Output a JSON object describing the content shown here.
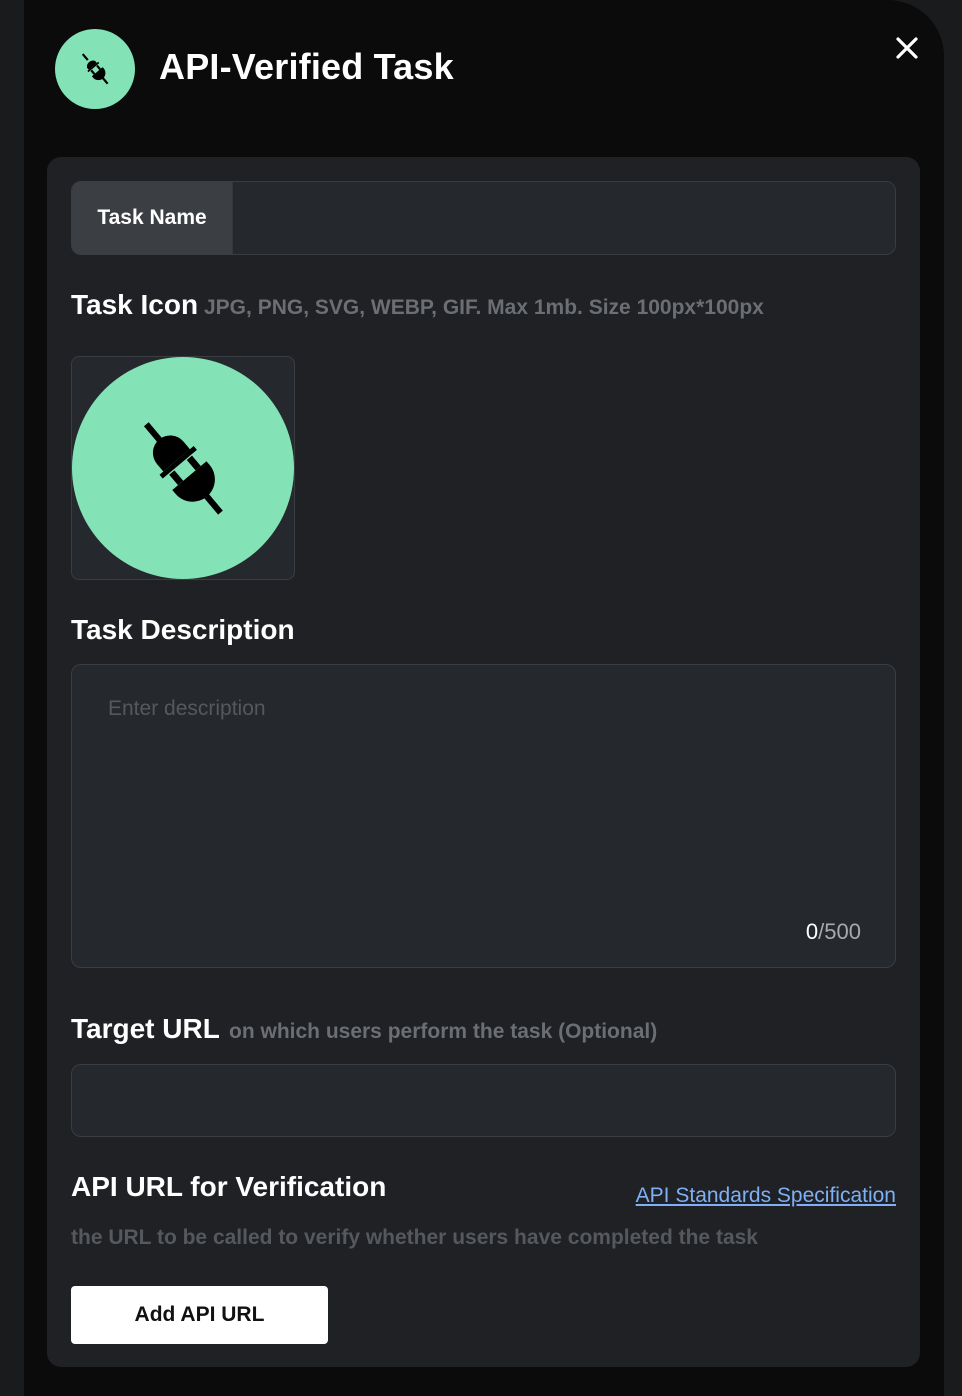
{
  "header": {
    "title": "API-Verified Task",
    "badge_icon": "plug-icon",
    "close_icon": "close-icon"
  },
  "colors": {
    "accent_green": "#84e3b6",
    "link_blue": "#7fb0f5",
    "background": "#0b0b0c",
    "panel": "#1f2124"
  },
  "task_name": {
    "label": "Task Name",
    "value": ""
  },
  "task_icon": {
    "title": "Task Icon",
    "hint": "JPG, PNG, SVG, WEBP, GIF. Max 1mb. Size 100px*100px",
    "preview_icon": "plug-icon"
  },
  "task_description": {
    "title": "Task Description",
    "placeholder": "Enter description",
    "count": "0",
    "max": "/500"
  },
  "target_url": {
    "title": "Target URL",
    "hint": "on which users perform the task (Optional)",
    "value": ""
  },
  "api_url": {
    "title": "API URL for Verification",
    "link_label": "API Standards Specification",
    "hint": "the URL to be called to verify whether users have completed the task",
    "button_label": "Add API URL"
  }
}
